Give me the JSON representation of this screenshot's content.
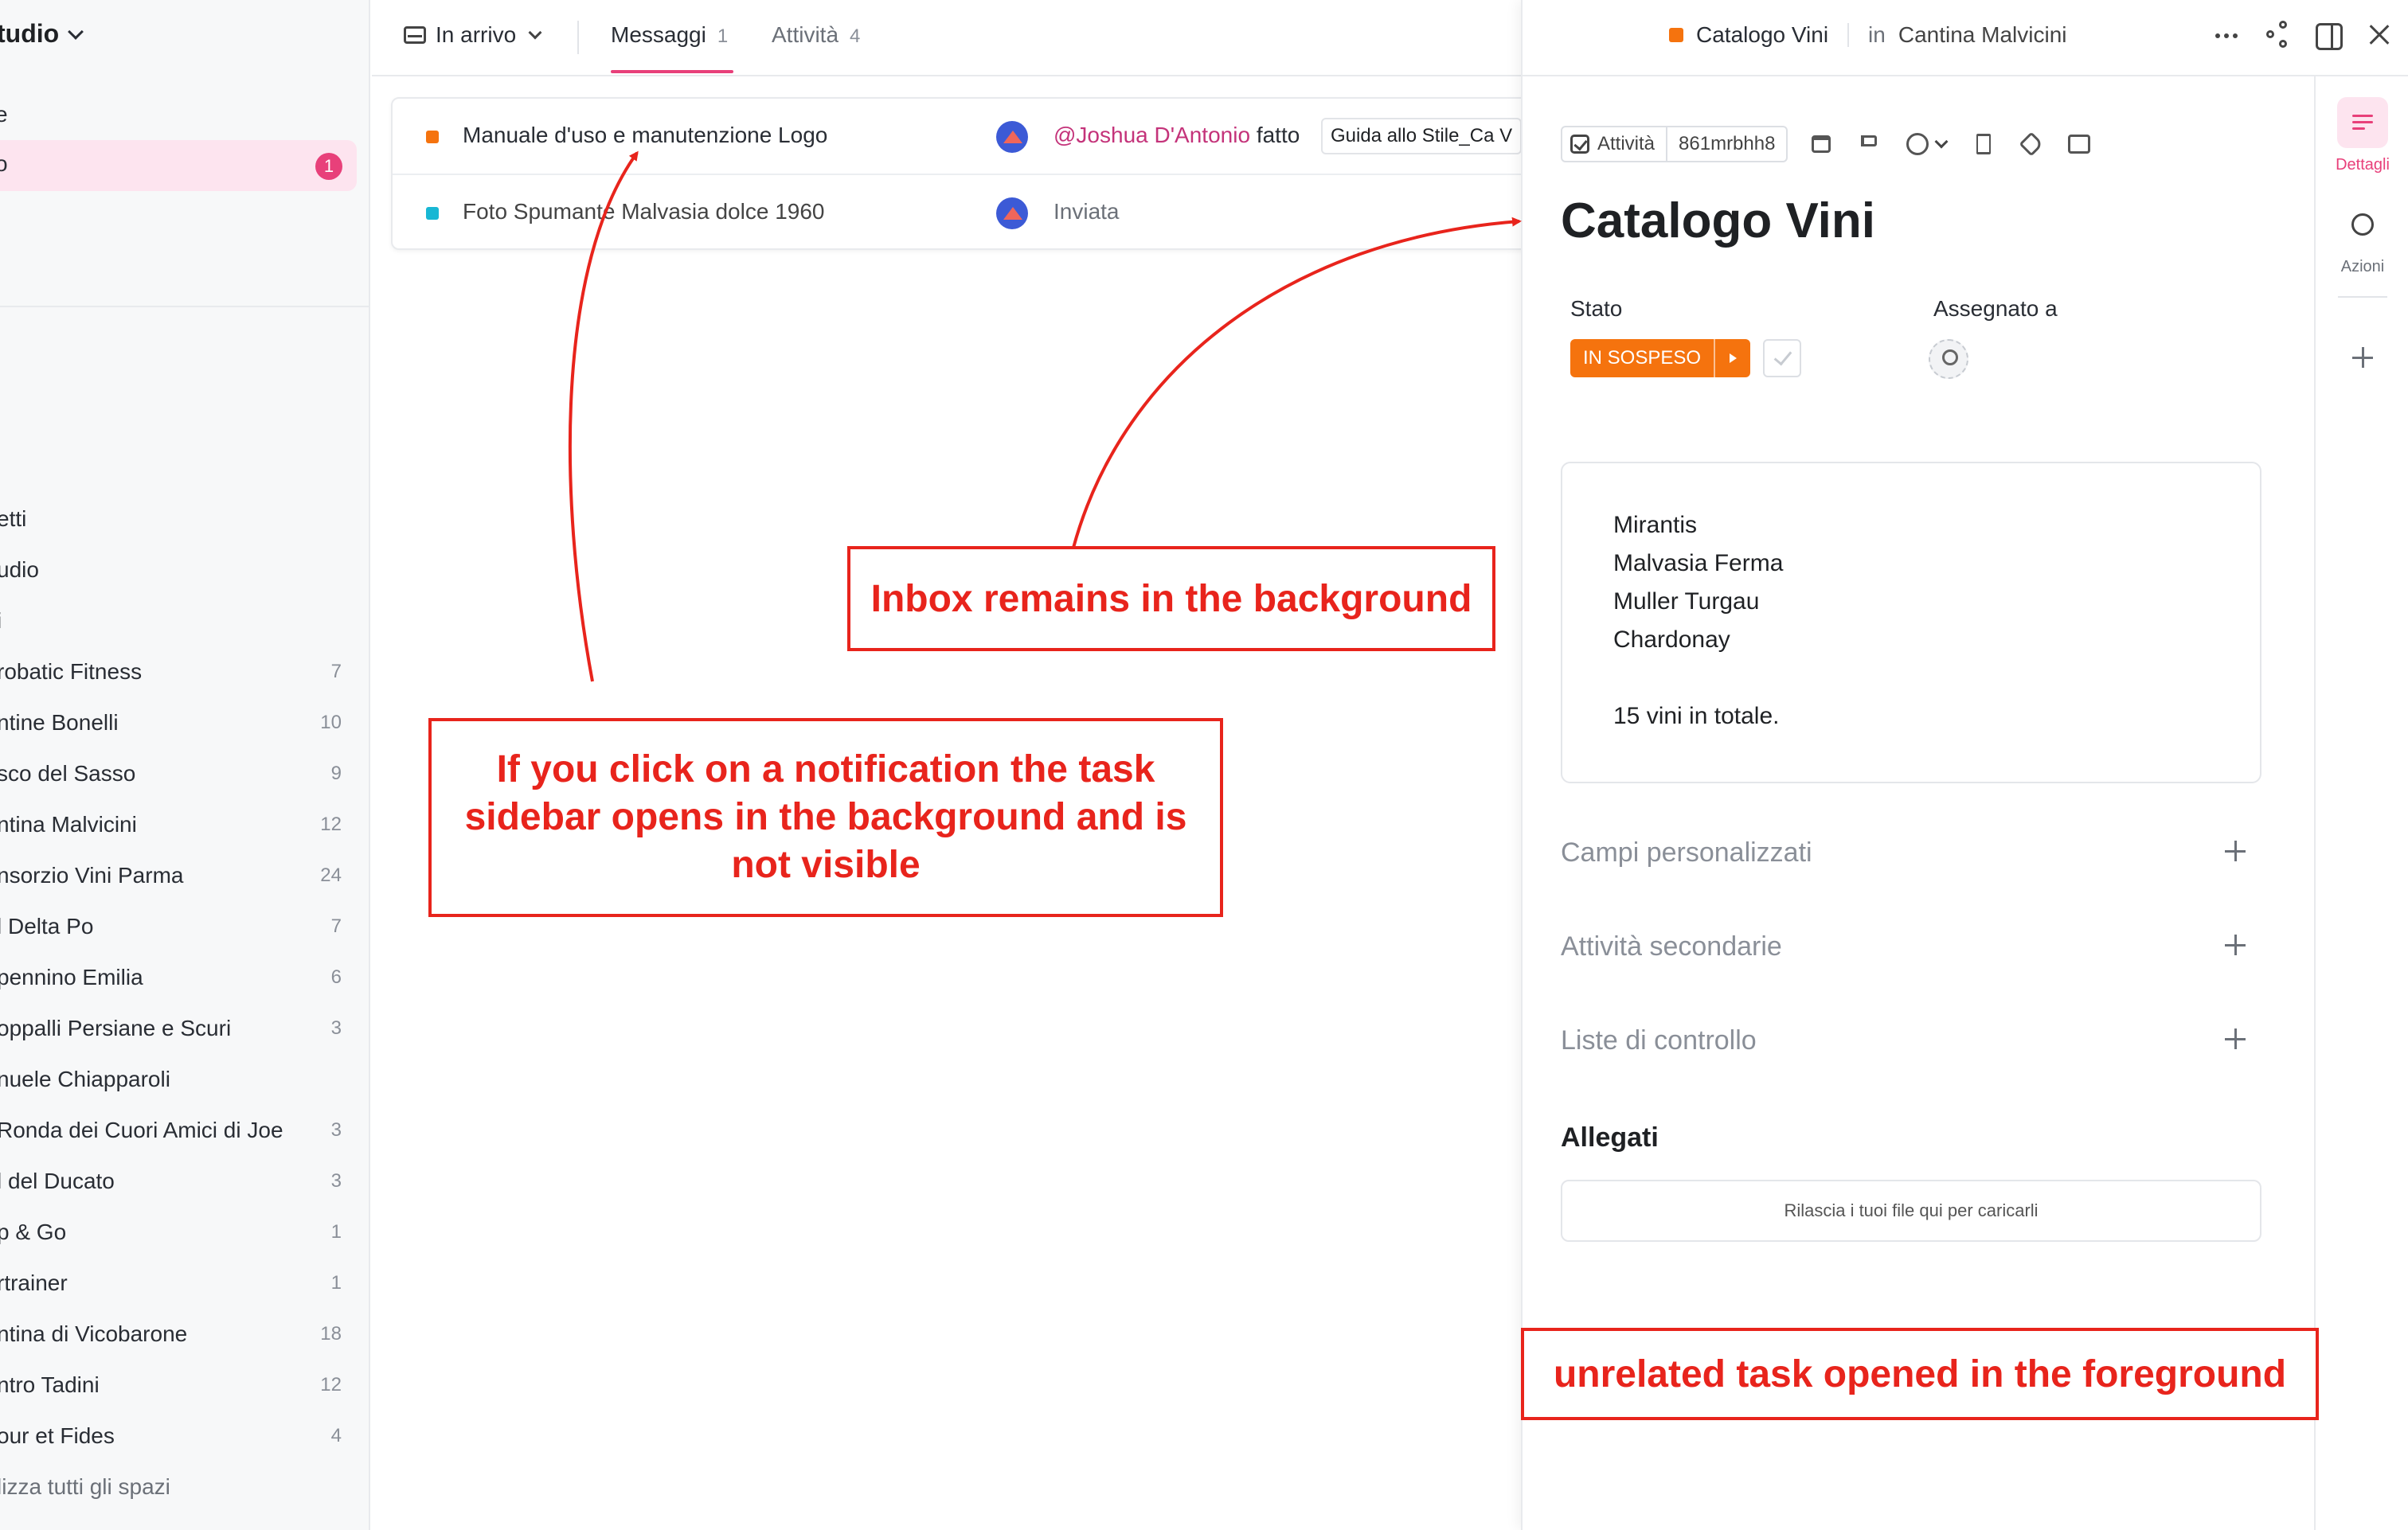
{
  "sidebar": {
    "workspace_name": "tudio",
    "top_items": [
      {
        "label": "e"
      },
      {
        "label": "o",
        "badge": "1"
      }
    ],
    "spaces": [
      {
        "name": "etti",
        "count": ""
      },
      {
        "name": "udio",
        "count": ""
      },
      {
        "name": "i",
        "count": ""
      },
      {
        "name": "robatic Fitness",
        "count": "7"
      },
      {
        "name": "ntine Bonelli",
        "count": "10"
      },
      {
        "name": "sco del Sasso",
        "count": "9"
      },
      {
        "name": "ntina Malvicini",
        "count": "12"
      },
      {
        "name": "nsorzio Vini Parma",
        "count": "24"
      },
      {
        "name": "l Delta Po",
        "count": "7"
      },
      {
        "name": "pennino Emilia",
        "count": "6"
      },
      {
        "name": "oppalli Persiane e Scuri",
        "count": "3"
      },
      {
        "name": "nuele Chiapparoli",
        "count": ""
      },
      {
        "name": "Ronda dei Cuori Amici di Joe",
        "count": "3"
      },
      {
        "name": "l del Ducato",
        "count": "3"
      },
      {
        "name": "p & Go",
        "count": "1"
      },
      {
        "name": "rtrainer",
        "count": "1"
      },
      {
        "name": "ntina di Vicobarone",
        "count": "18"
      },
      {
        "name": "ntro Tadini",
        "count": "12"
      },
      {
        "name": "our et Fides",
        "count": "4"
      },
      {
        "name": "lizza tutti gli spazi",
        "count": ""
      }
    ]
  },
  "inbox": {
    "filter_label": "In arrivo",
    "tabs": [
      {
        "label": "Messaggi",
        "count": "1"
      },
      {
        "label": "Attività",
        "count": "4"
      }
    ],
    "notifications": [
      {
        "title": "Manuale d'uso e manutenzione Logo",
        "mention": "@Joshua D'Antonio",
        "action": "fatto",
        "chip": "Guida allo Stile_Ca V",
        "color": "#f5730e"
      },
      {
        "title": "Foto Spumante Malvasia dolce 1960",
        "mention": "",
        "action": "Inviata",
        "chip": "",
        "color": "#18b7d4"
      }
    ]
  },
  "task": {
    "breadcrumb_title": "Catalogo Vini",
    "breadcrumb_in": "in",
    "breadcrumb_location": "Cantina Malvicini",
    "type_label": "Attività",
    "task_id": "861mrbhh8",
    "title": "Catalogo Vini",
    "status_label": "Stato",
    "status_value": "IN SOSPESO",
    "assignee_label": "Assegnato a",
    "description_lines": [
      "Mirantis",
      "Malvasia Ferma",
      "Muller Turgau",
      "Chardonay",
      "",
      "15 vini in totale."
    ],
    "sections": {
      "custom_fields": "Campi personalizzati",
      "subtasks": "Attività secondarie",
      "checklists": "Liste di controllo",
      "attachments": "Allegati"
    },
    "drop_text": "Rilascia i tuoi file qui per caricarli",
    "rail": {
      "details": "Dettagli",
      "actions": "Azioni"
    }
  },
  "annotations": {
    "inbox_bg": "Inbox remains in the background",
    "click_notice": "If you click on a notification the task sidebar opens in the background and is not visible",
    "unrelated": "unrelated task opened in the foreground"
  },
  "colors": {
    "accent_pink": "#e8407a",
    "status_orange": "#f5730e",
    "annotation_red": "#e8241c"
  }
}
